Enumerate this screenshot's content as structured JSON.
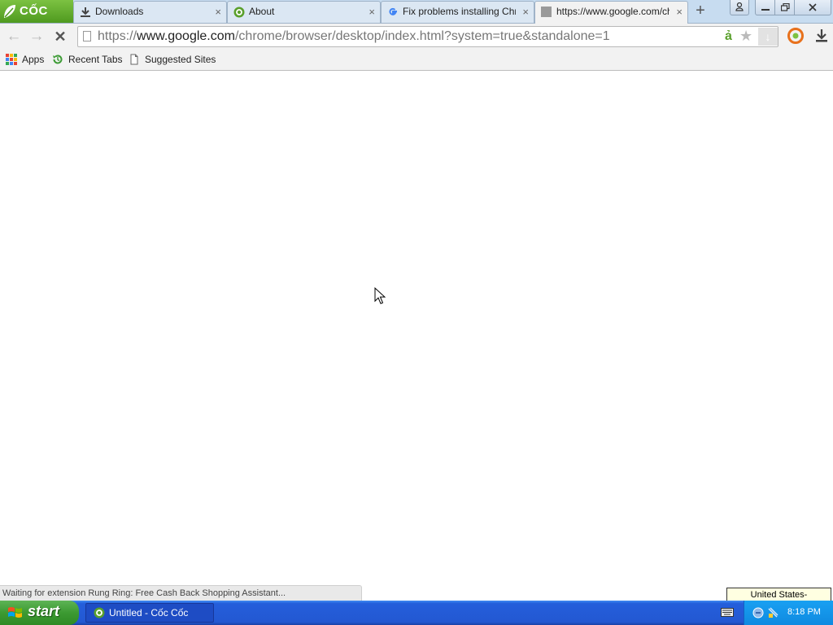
{
  "browser": {
    "brand_name": "CỐC CỐC",
    "tabs": [
      {
        "label": "Downloads",
        "icon": "download-icon",
        "close": "×"
      },
      {
        "label": "About",
        "icon": "coccoc-icon",
        "close": "×"
      },
      {
        "label": "Fix problems installing Chrome",
        "icon": "google-g-icon",
        "close": "×"
      },
      {
        "label": "https://www.google.com/ch",
        "icon": "page-icon",
        "close": "×",
        "active": true
      }
    ],
    "new_tab": "+"
  },
  "toolbar": {
    "back": "back-arrow-icon",
    "forward": "forward-arrow-icon",
    "stop": "stop-icon",
    "url_scheme": "https://",
    "url_domain": "www.google.com",
    "url_path": "/chrome/browser/desktop/index.html?system=true&standalone=1",
    "omnibox_letter": "ả"
  },
  "bookmarks": [
    {
      "label": "Apps",
      "icon": "apps-grid-icon"
    },
    {
      "label": "Recent Tabs",
      "icon": "recent-tabs-icon"
    },
    {
      "label": "Suggested Sites",
      "icon": "page-icon"
    }
  ],
  "status": {
    "text": "Waiting for extension Rung Ring: Free Cash Back Shopping Assistant...",
    "tooltip": "United States-International"
  },
  "taskbar": {
    "start_label": "start",
    "task_item": "Untitled - Cốc Cốc",
    "clock": "8:18 PM"
  },
  "colors": {
    "brand_green": "#5aa02c",
    "taskbar_blue": "#245edb",
    "start_green": "#3c9a32"
  }
}
